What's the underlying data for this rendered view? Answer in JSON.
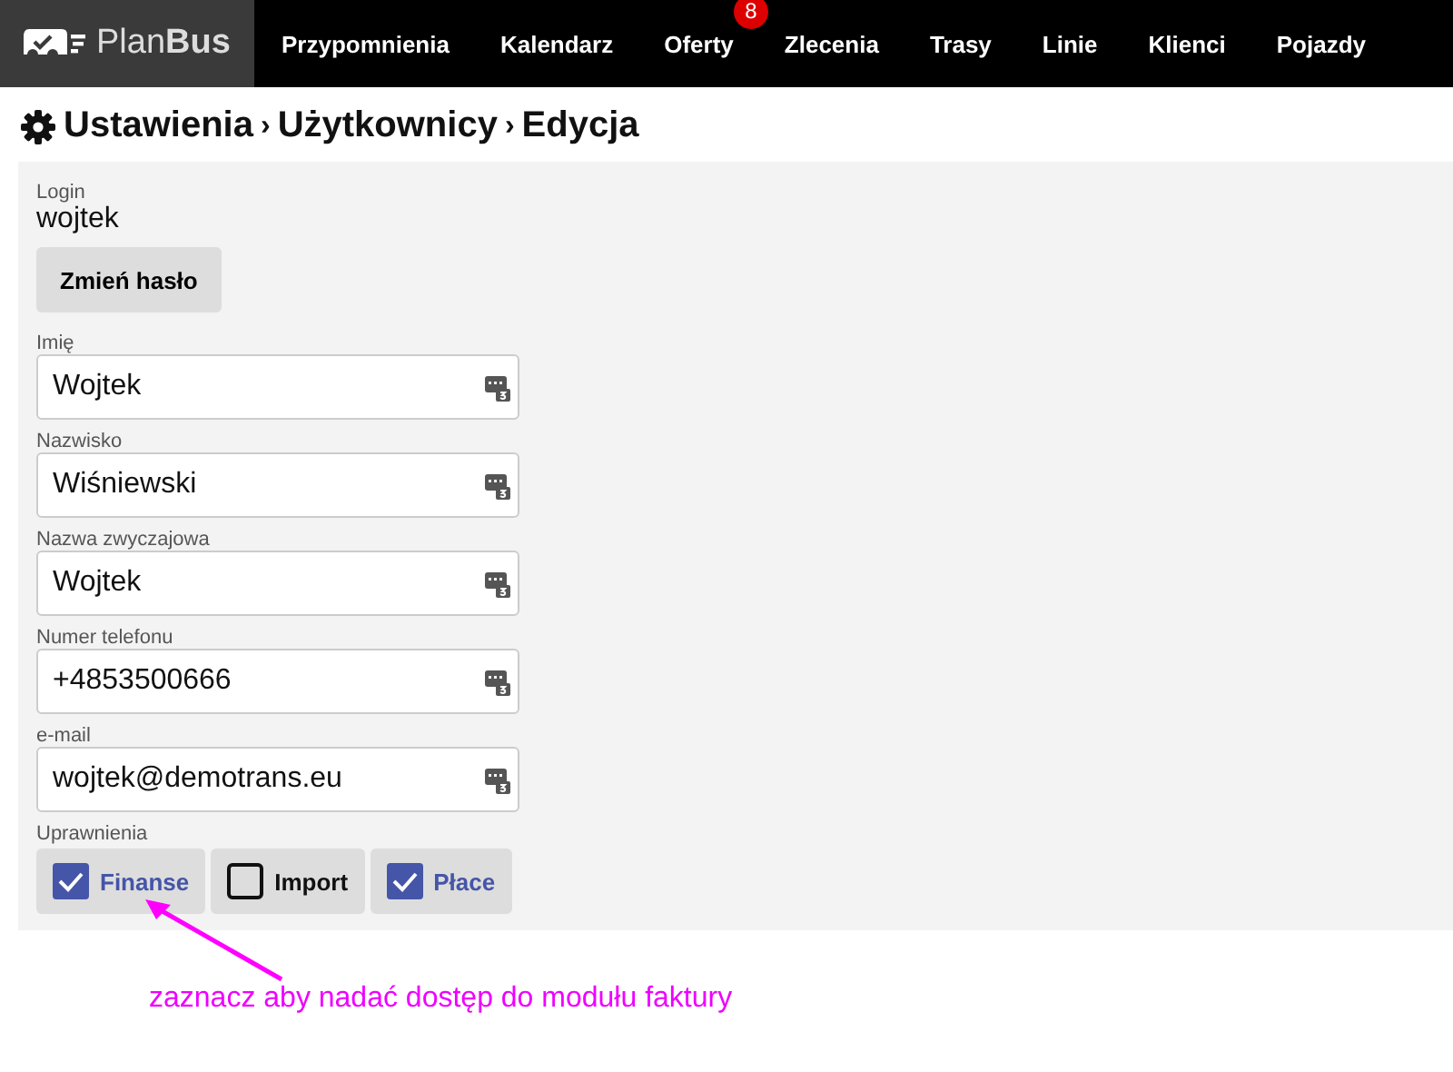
{
  "logo": {
    "text": "Plan**Bus**"
  },
  "nav": [
    {
      "label": "Przypomnienia"
    },
    {
      "label": "Kalendarz"
    },
    {
      "label": "Oferty",
      "badge": "8"
    },
    {
      "label": "Zlecenia"
    },
    {
      "label": "Trasy"
    },
    {
      "label": "Linie"
    },
    {
      "label": "Klienci"
    },
    {
      "label": "Pojazdy"
    }
  ],
  "breadcrumb": [
    "Ustawienia",
    "›",
    "Użytkownicy",
    "›",
    "Edycja"
  ],
  "login": {
    "label": "Login",
    "value": "wojtek"
  },
  "change_password_button": "Zmień hasło",
  "fields": [
    {
      "label": "Imię",
      "value": "Wojtek"
    },
    {
      "label": "Nazwisko",
      "value": "Wiśniewski"
    },
    {
      "label": "Nazwa zwyczajowa",
      "value": "Wojtek"
    },
    {
      "label": "Numer telefonu",
      "value": "+4853500666"
    },
    {
      "label": "e-mail",
      "value": "wojtek@demotrans.eu"
    }
  ],
  "permissions": {
    "label": "Uprawnienia",
    "items": [
      {
        "label": "Finanse",
        "checked": true
      },
      {
        "label": "Import",
        "checked": false
      },
      {
        "label": "Płace",
        "checked": true
      }
    ]
  },
  "annotation": "zaznacz aby nadać dostęp do modułu faktury"
}
